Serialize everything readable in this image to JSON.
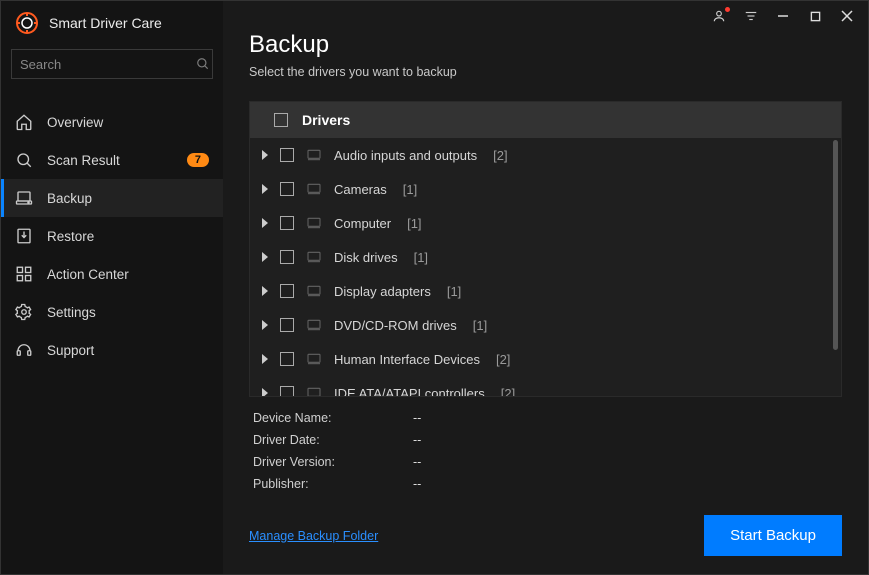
{
  "app": {
    "title": "Smart Driver Care"
  },
  "search": {
    "placeholder": "Search"
  },
  "sidebar": {
    "items": [
      {
        "label": "Overview"
      },
      {
        "label": "Scan Result",
        "badge": "7"
      },
      {
        "label": "Backup"
      },
      {
        "label": "Restore"
      },
      {
        "label": "Action Center"
      },
      {
        "label": "Settings"
      },
      {
        "label": "Support"
      }
    ],
    "activeIndex": 2
  },
  "page": {
    "title": "Backup",
    "subtitle": "Select the drivers you want to backup"
  },
  "driverList": {
    "headerLabel": "Drivers",
    "categories": [
      {
        "name": "Audio inputs and outputs",
        "count": 2
      },
      {
        "name": "Cameras",
        "count": 1
      },
      {
        "name": "Computer",
        "count": 1
      },
      {
        "name": "Disk drives",
        "count": 1
      },
      {
        "name": "Display adapters",
        "count": 1
      },
      {
        "name": "DVD/CD-ROM drives",
        "count": 1
      },
      {
        "name": "Human Interface Devices",
        "count": 2
      },
      {
        "name": "IDE ATA/ATAPI controllers",
        "count": 2
      }
    ]
  },
  "details": {
    "rows": [
      {
        "label": "Device Name:",
        "value": "--"
      },
      {
        "label": "Driver Date:",
        "value": "--"
      },
      {
        "label": "Driver Version:",
        "value": "--"
      },
      {
        "label": "Publisher:",
        "value": "--"
      }
    ]
  },
  "footer": {
    "manageLink": "Manage Backup Folder",
    "startButton": "Start Backup"
  }
}
